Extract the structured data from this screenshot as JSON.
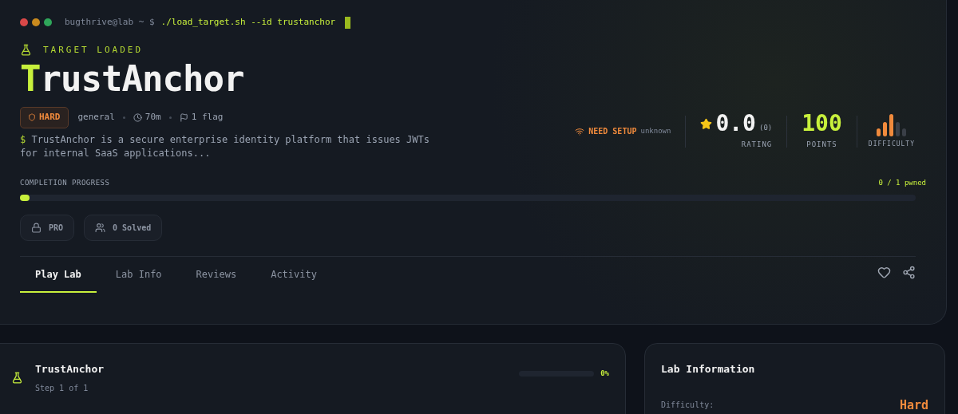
{
  "terminal": {
    "prompt": "bugthrive@lab ~ $",
    "command": "./load_target.sh --id trustanchor"
  },
  "header": {
    "eyebrow": "TARGET LOADED",
    "title": "TrustAnchor",
    "difficulty_badge": "HARD",
    "category": "general",
    "duration": "70m",
    "flags": "1 flag",
    "prompt_sign": "$",
    "description": "TrustAnchor is a secure enterprise identity platform that issues JWTs for internal SaaS applications..."
  },
  "status": {
    "label": "NEED SETUP",
    "detail": "unknown"
  },
  "stats": {
    "rating": "0.0",
    "rating_count": "(0)",
    "rating_label": "RATING",
    "points": "100",
    "points_label": "POINTS",
    "difficulty_label": "DIFFICULTY",
    "difficulty_meter": {
      "level": 0.6
    }
  },
  "progress": {
    "label": "COMPLETION PROGRESS",
    "reading": "0 / 1 pwned",
    "level": 0
  },
  "chips": [
    {
      "kind": "lock",
      "label": "PRO"
    },
    {
      "kind": "users",
      "label": "0 Solved"
    }
  ],
  "tabs": [
    {
      "label": "Play Lab",
      "selected": true
    },
    {
      "label": "Lab Info",
      "selected": false
    },
    {
      "label": "Reviews",
      "selected": false
    },
    {
      "label": "Activity",
      "selected": false
    }
  ],
  "step_card": {
    "title": "TrustAnchor",
    "subtitle": "Step 1 of 1",
    "level": 0,
    "reading": "0%"
  },
  "info_card": {
    "title": "Lab Information",
    "rows": [
      {
        "label": "Difficulty:",
        "value": "Hard"
      }
    ]
  }
}
